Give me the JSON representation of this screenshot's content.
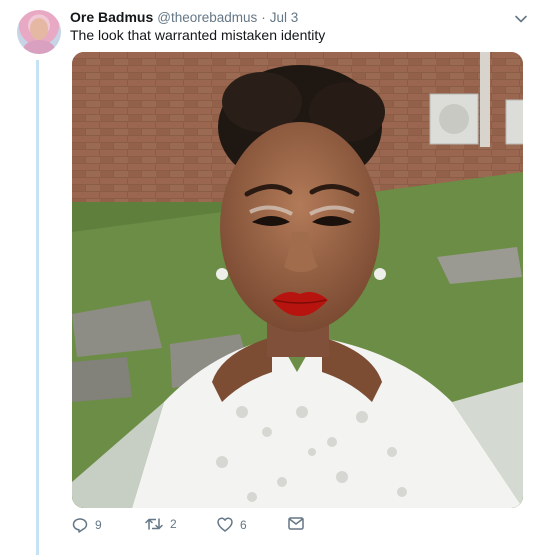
{
  "tweet": {
    "author_name": "Ore Badmus",
    "handle": "@theorebadmus",
    "separator": "·",
    "date": "Jul 3",
    "text": "The look that warranted mistaken identity"
  },
  "actions": {
    "reply_count": "9",
    "retweet_count": "2",
    "like_count": "6"
  },
  "icons": {
    "reply": "reply-icon",
    "retweet": "retweet-icon",
    "like": "heart-icon",
    "dm": "envelope-icon",
    "menu": "chevron-down-icon"
  },
  "colors": {
    "thread_line": "#c6e3f4",
    "secondary_text": "#657786",
    "primary_text": "#14171a"
  }
}
